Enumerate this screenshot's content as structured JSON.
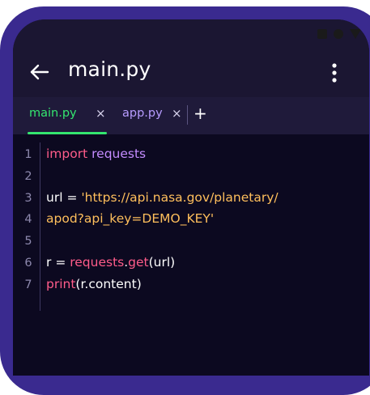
{
  "app_bar": {
    "title": "main.py",
    "back_icon": "arrow-left-icon",
    "menu_icon": "more-vertical-icon"
  },
  "tabs": [
    {
      "label": "main.py",
      "active": true,
      "close": "×",
      "color": "#34e66f"
    },
    {
      "label": "app.py",
      "active": false,
      "close": "×",
      "color": "#b79cff"
    }
  ],
  "add_tab_label": "+",
  "code": {
    "lines": [
      {
        "number": "1",
        "tokens": [
          {
            "t": "import",
            "k": "keyword"
          },
          {
            "t": " ",
            "k": "plain"
          },
          {
            "t": "requests",
            "k": "module"
          }
        ]
      },
      {
        "number": "2",
        "tokens": []
      },
      {
        "number": "3",
        "tokens": [
          {
            "t": "url ",
            "k": "plain"
          },
          {
            "t": "= ",
            "k": "plain"
          },
          {
            "t": "'https://api.nasa.gov/planetary/",
            "k": "string"
          }
        ]
      },
      {
        "number": "4",
        "tokens": [
          {
            "t": "apod?api_key=DEMO_KEY'",
            "k": "string"
          }
        ]
      },
      {
        "number": "5",
        "tokens": []
      },
      {
        "number": "6",
        "tokens": [
          {
            "t": "r ",
            "k": "plain"
          },
          {
            "t": "= ",
            "k": "plain"
          },
          {
            "t": "requests",
            "k": "func"
          },
          {
            "t": ".",
            "k": "plain"
          },
          {
            "t": "get",
            "k": "func"
          },
          {
            "t": "(url)",
            "k": "plain"
          }
        ]
      },
      {
        "number": "7",
        "tokens": [
          {
            "t": "print",
            "k": "func"
          },
          {
            "t": "(r.content)",
            "k": "plain"
          }
        ]
      }
    ]
  },
  "colors": {
    "frame": "#3a2a8f",
    "app_bar": "#1b1632",
    "tab_bar": "#1f1a3a",
    "editor_bg": "#0c0920",
    "active_tab": "#34e66f",
    "keyword": "#ff5c8a",
    "module": "#c48cff",
    "string": "#ffbf5c"
  }
}
